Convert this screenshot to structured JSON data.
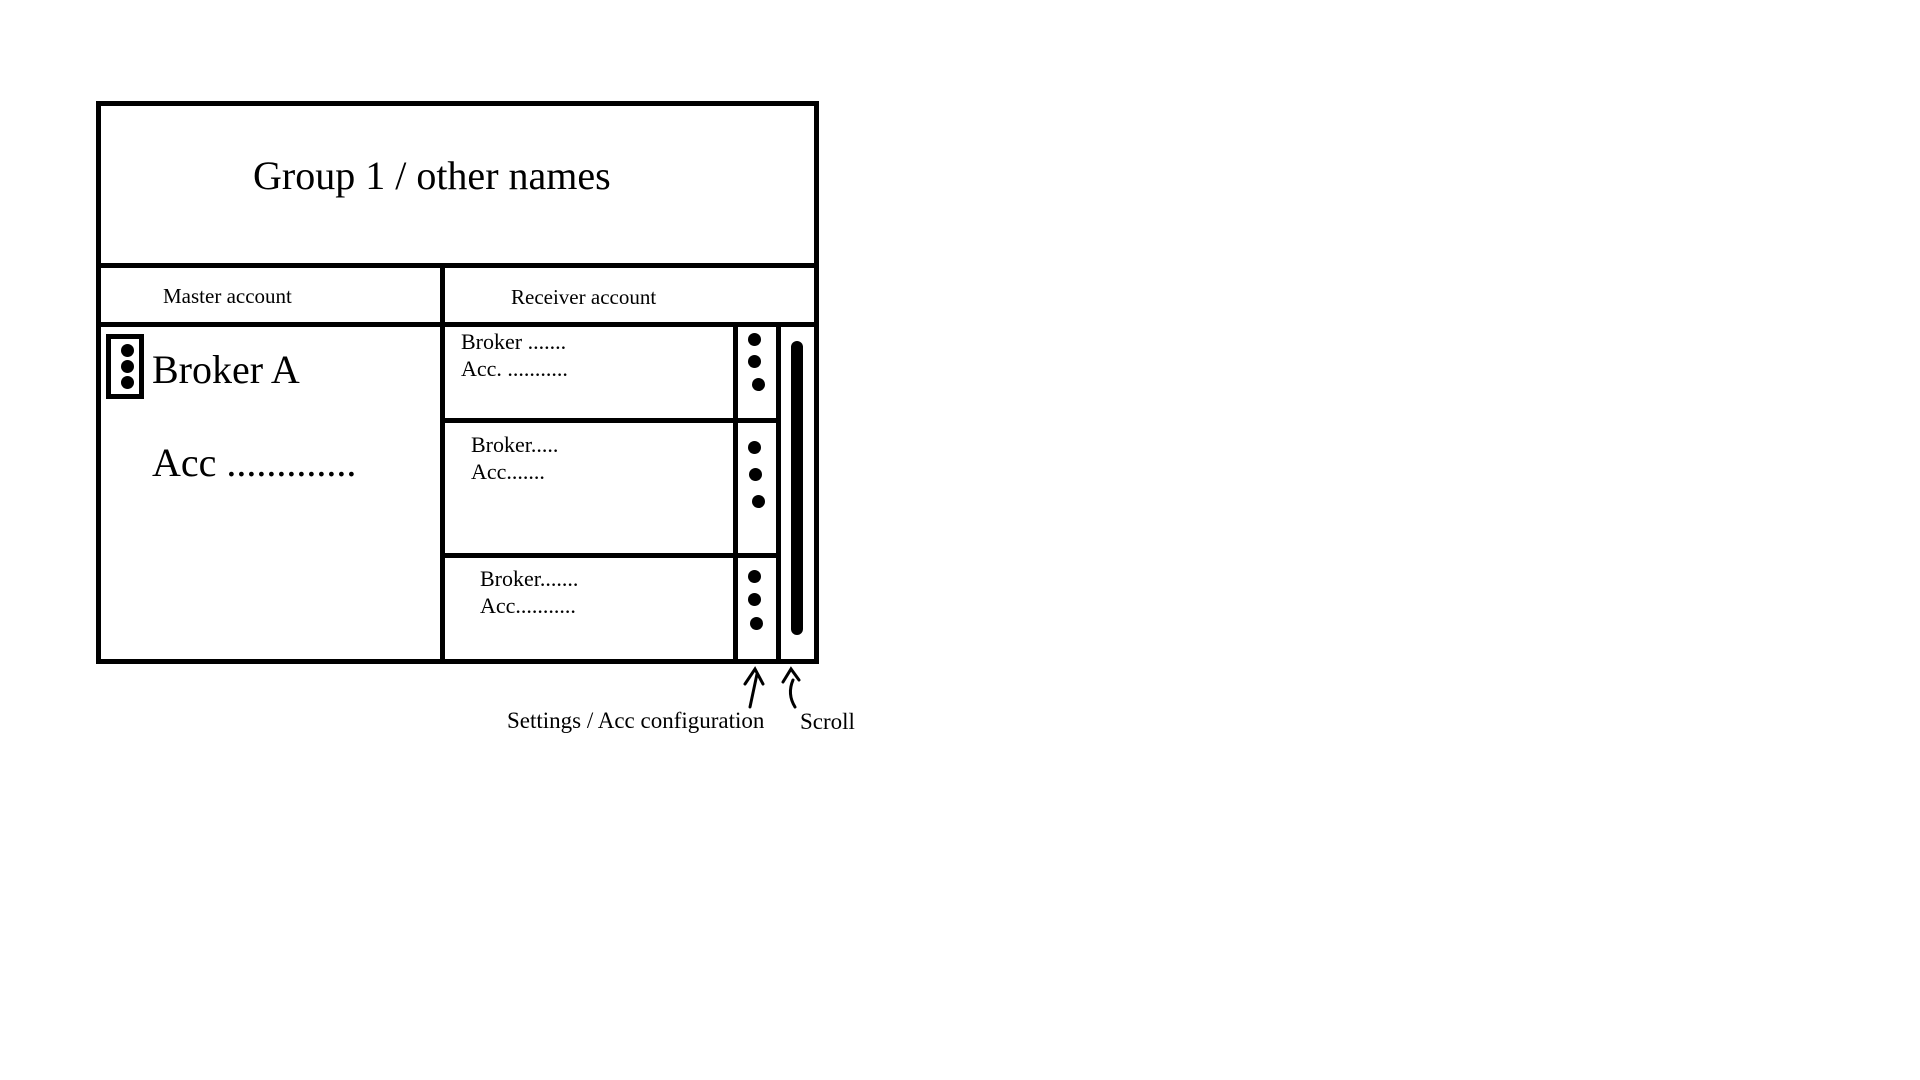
{
  "header": {
    "title": "Group 1 / other names"
  },
  "columns": {
    "master": "Master account",
    "receiver": "Receiver account"
  },
  "master": {
    "broker": "Broker A",
    "account": "Acc .............",
    "menu_icon": "kebab-menu-icon"
  },
  "receivers": [
    {
      "broker": "Broker .......",
      "account": "Acc. ...........",
      "menu_icon": "kebab-menu-icon"
    },
    {
      "broker": "Broker.....",
      "account": "Acc.......",
      "menu_icon": "kebab-menu-icon"
    },
    {
      "broker": "Broker.......",
      "account": "Acc...........",
      "menu_icon": "kebab-menu-icon"
    }
  ],
  "annotations": {
    "settings": "Settings / Acc configuration",
    "scroll": "Scroll"
  }
}
